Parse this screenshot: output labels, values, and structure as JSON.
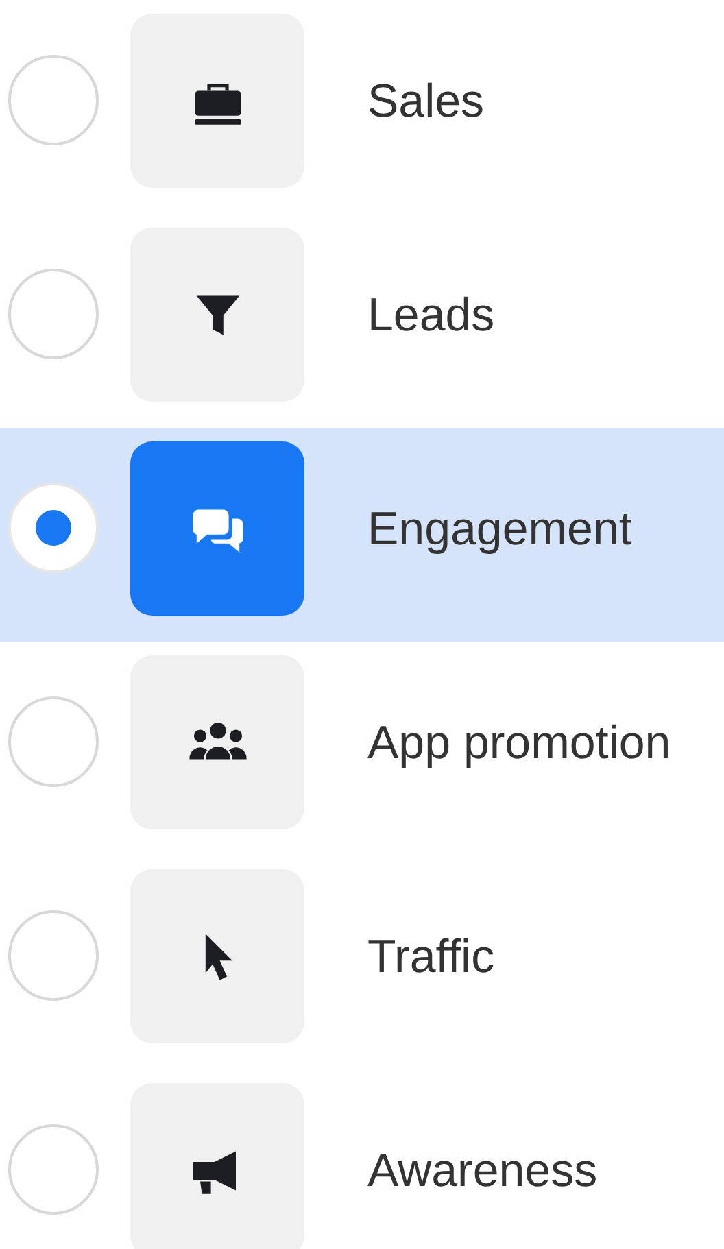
{
  "objectives": [
    {
      "label": "Sales",
      "selected": false
    },
    {
      "label": "Leads",
      "selected": false
    },
    {
      "label": "Engagement",
      "selected": true
    },
    {
      "label": "App promotion",
      "selected": false
    },
    {
      "label": "Traffic",
      "selected": false
    },
    {
      "label": "Awareness",
      "selected": false
    }
  ]
}
